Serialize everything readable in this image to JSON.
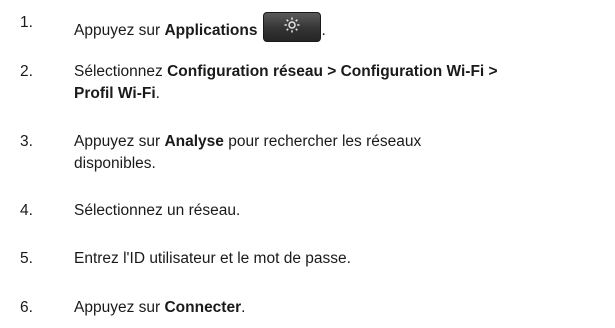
{
  "steps": [
    {
      "number": "1.",
      "prefix": "Appuyez sur ",
      "bold": "Applications",
      "suffix": ".",
      "icon": "gear-settings-key-icon"
    },
    {
      "number": "2.",
      "prefix": "Sélectionnez ",
      "bold_line1": "Configuration réseau > Configuration Wi-Fi >",
      "bold_line2": "Profil Wi-Fi",
      "suffix": "."
    },
    {
      "number": "3.",
      "prefix": "Appuyez sur ",
      "bold": "Analyse",
      "suffix_line1": " pour rechercher les réseaux",
      "line2": "disponibles."
    },
    {
      "number": "4.",
      "text": "Sélectionnez un réseau."
    },
    {
      "number": "5.",
      "text": "Entrez l'ID utilisateur et le mot de passe."
    },
    {
      "number": "6.",
      "prefix": "Appuyez sur ",
      "bold": "Connecter",
      "suffix": "."
    }
  ]
}
